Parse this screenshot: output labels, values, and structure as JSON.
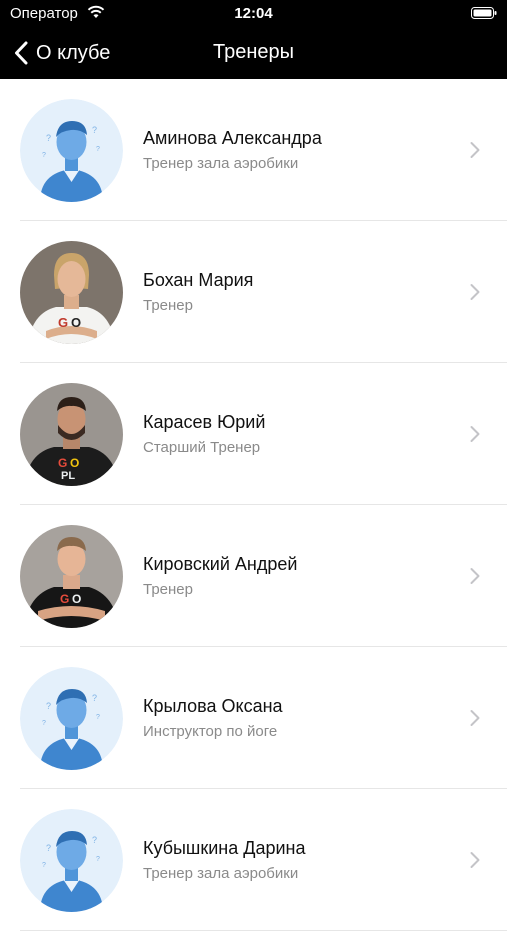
{
  "status_bar": {
    "carrier": "Оператор",
    "time": "12:04"
  },
  "navbar": {
    "back_label": "О клубе",
    "title": "Тренеры"
  },
  "trainers": [
    {
      "name": "Аминова Александра",
      "role": "Тренер зала аэробики",
      "avatar": "placeholder"
    },
    {
      "name": "Бохан Мария",
      "role": "Тренер",
      "avatar": "photo"
    },
    {
      "name": "Карасев Юрий",
      "role": "Старший Тренер",
      "avatar": "photo"
    },
    {
      "name": "Кировский Андрей",
      "role": "Тренер",
      "avatar": "photo"
    },
    {
      "name": "Крылова Оксана",
      "role": "Инструктор по йоге",
      "avatar": "placeholder"
    },
    {
      "name": "Кубышкина Дарина",
      "role": "Тренер зала аэробики",
      "avatar": "placeholder"
    }
  ]
}
